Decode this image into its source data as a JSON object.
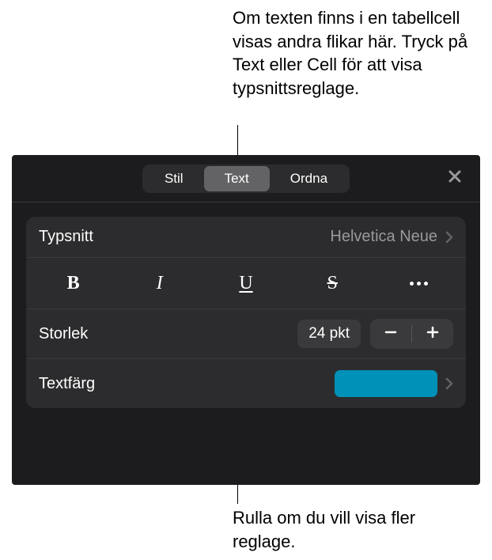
{
  "callouts": {
    "top": "Om texten finns i en tabellcell visas andra flikar här. Tryck på Text eller Cell för att visa typsnittsreglage.",
    "bottom": "Rulla om du vill visa fler reglage."
  },
  "tabs": {
    "stil": "Stil",
    "text": "Text",
    "ordna": "Ordna"
  },
  "font": {
    "label": "Typsnitt",
    "value": "Helvetica Neue"
  },
  "styles": {
    "bold": "B",
    "italic": "I",
    "underline": "U",
    "strike": "S"
  },
  "size": {
    "label": "Storlek",
    "value": "24 pkt"
  },
  "color": {
    "label": "Textfärg",
    "value": "#0091b9"
  }
}
